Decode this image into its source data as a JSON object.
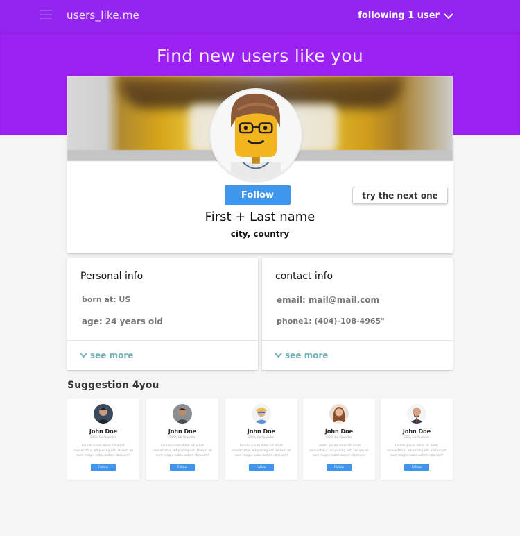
{
  "header": {
    "brand": "users_like.me",
    "following_label": "following 1 user"
  },
  "hero": {
    "title": "Find new users like you"
  },
  "profile": {
    "follow_label": "Follow",
    "next_label": "try the next one",
    "name": "First + Last name",
    "location": "city, country"
  },
  "personal_info": {
    "title": "Personal info",
    "born": "born at: US",
    "age": "age: 24 years old",
    "see_more": "see more"
  },
  "contact_info": {
    "title": "contact info",
    "email": "email: mail@mail.com",
    "phone": "phone1: (404)-108-4965\"",
    "see_more": "see more"
  },
  "suggestions": {
    "title": "Suggestion 4you",
    "items": [
      {
        "name": "John Doe",
        "role": "CEO, Co-founder",
        "desc": "Lorem ipsum dolor sit amet consectetur, adipiscing elit. Harum ab eum magni nobis autem dolorum!",
        "follow": "Follow"
      },
      {
        "name": "John Doe",
        "role": "CEO, Co-founder",
        "desc": "Lorem ipsum dolor sit amet consectetur, adipiscing elit. Harum ab eum magni nobis autem dolorum!",
        "follow": "Follow"
      },
      {
        "name": "John Doe",
        "role": "CEO, Co-founder",
        "desc": "Lorem ipsum dolor sit amet consectetur, adipiscing elit. Harum ab eum magni nobis autem dolorum!",
        "follow": "Follow"
      },
      {
        "name": "John Doe",
        "role": "CEO, Co-founder",
        "desc": "Lorem ipsum dolor sit amet consectetur, adipiscing elit. Harum ab eum magni nobis autem dolorum!",
        "follow": "Follow"
      },
      {
        "name": "John Doe",
        "role": "CEO, Co-founder",
        "desc": "Lorem ipsum dolor sit amet consectetur, adipiscing elit. Harum ab eum magni nobis autem dolorum!",
        "follow": "Follow"
      }
    ]
  },
  "colors": {
    "brand_purple": "#9b22f3",
    "primary_blue": "#3e97ec",
    "link_teal": "#71b0b8"
  }
}
